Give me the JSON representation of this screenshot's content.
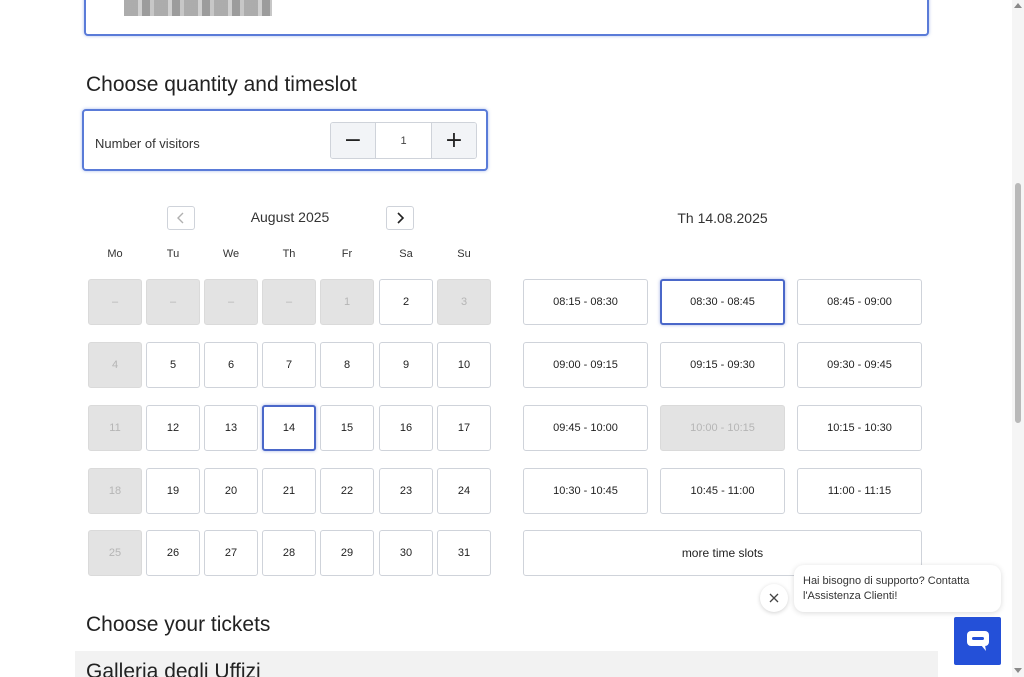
{
  "headings": {
    "quantity_timeslot": "Choose quantity and timeslot",
    "tickets": "Choose your tickets"
  },
  "visitors": {
    "label": "Number of visitors",
    "decrement": "−",
    "value": "1",
    "increment": "+"
  },
  "calendar": {
    "month": "August 2025",
    "weekdays": [
      "Mo",
      "Tu",
      "We",
      "Th",
      "Fr",
      "Sa",
      "Su"
    ],
    "selected_day": "14",
    "weeks": [
      [
        {
          "label": "–",
          "state": "disabled"
        },
        {
          "label": "–",
          "state": "disabled"
        },
        {
          "label": "–",
          "state": "disabled"
        },
        {
          "label": "–",
          "state": "disabled"
        },
        {
          "label": "1",
          "state": "disabled"
        },
        {
          "label": "2",
          "state": "available"
        },
        {
          "label": "3",
          "state": "disabled"
        }
      ],
      [
        {
          "label": "4",
          "state": "disabled"
        },
        {
          "label": "5",
          "state": "available"
        },
        {
          "label": "6",
          "state": "available"
        },
        {
          "label": "7",
          "state": "available"
        },
        {
          "label": "8",
          "state": "available"
        },
        {
          "label": "9",
          "state": "available"
        },
        {
          "label": "10",
          "state": "available"
        }
      ],
      [
        {
          "label": "11",
          "state": "disabled"
        },
        {
          "label": "12",
          "state": "available"
        },
        {
          "label": "13",
          "state": "available"
        },
        {
          "label": "14",
          "state": "selected"
        },
        {
          "label": "15",
          "state": "available"
        },
        {
          "label": "16",
          "state": "available"
        },
        {
          "label": "17",
          "state": "available"
        }
      ],
      [
        {
          "label": "18",
          "state": "disabled"
        },
        {
          "label": "19",
          "state": "available"
        },
        {
          "label": "20",
          "state": "available"
        },
        {
          "label": "21",
          "state": "available"
        },
        {
          "label": "22",
          "state": "available"
        },
        {
          "label": "23",
          "state": "available"
        },
        {
          "label": "24",
          "state": "available"
        }
      ],
      [
        {
          "label": "25",
          "state": "disabled"
        },
        {
          "label": "26",
          "state": "available"
        },
        {
          "label": "27",
          "state": "available"
        },
        {
          "label": "28",
          "state": "available"
        },
        {
          "label": "29",
          "state": "available"
        },
        {
          "label": "30",
          "state": "available"
        },
        {
          "label": "31",
          "state": "available"
        }
      ]
    ]
  },
  "timeslots": {
    "date": "Th 14.08.2025",
    "slots": [
      {
        "label": "08:15 - 08:30",
        "state": "available"
      },
      {
        "label": "08:30 - 08:45",
        "state": "selected"
      },
      {
        "label": "08:45 - 09:00",
        "state": "available"
      },
      {
        "label": "09:00 - 09:15",
        "state": "available"
      },
      {
        "label": "09:15 - 09:30",
        "state": "available"
      },
      {
        "label": "09:30 - 09:45",
        "state": "available"
      },
      {
        "label": "09:45 - 10:00",
        "state": "available"
      },
      {
        "label": "10:00 - 10:15",
        "state": "disabled"
      },
      {
        "label": "10:15 - 10:30",
        "state": "available"
      },
      {
        "label": "10:30 - 10:45",
        "state": "available"
      },
      {
        "label": "10:45 - 11:00",
        "state": "available"
      },
      {
        "label": "11:00 - 11:15",
        "state": "available"
      }
    ],
    "more_label": "more time slots"
  },
  "chat": {
    "message": "Hai bisogno di supporto? Contatta l'Assistenza Clienti!"
  },
  "ticket_section": {
    "title": "Galleria degli Uffizi"
  },
  "colors": {
    "accent": "#4a67c9",
    "chat_button": "#2450d8",
    "disabled_bg": "#e3e3e3"
  },
  "icons": {
    "prev": "chevron-left-icon",
    "next": "chevron-right-icon",
    "close": "close-icon",
    "chat": "chat-bubble-icon"
  }
}
